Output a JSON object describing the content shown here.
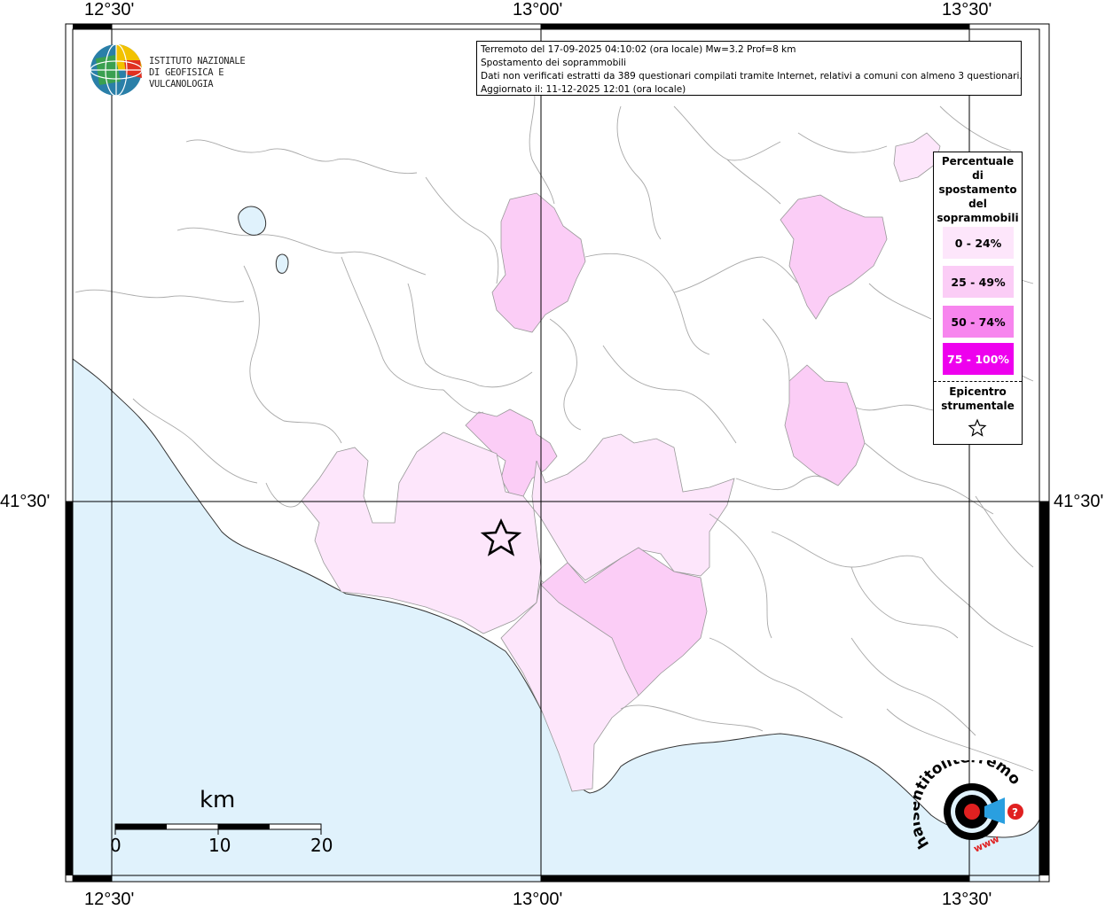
{
  "map": {
    "lon_labels": [
      "12°30'",
      "13°00'",
      "13°30'"
    ],
    "lat_label": "41°30'",
    "colors": {
      "sea": "#e0f2fc",
      "land": "#ffffff",
      "border": "#aaaaaa",
      "c0_24": "#fde6fb",
      "c25_49": "#fbcdf6",
      "c50_74": "#f785ee",
      "c75_100": "#ee00ee"
    }
  },
  "info": {
    "line1": "Terremoto del 17-09-2025 04:10:02 (ora locale) Mw=3.2 Prof=8 km",
    "line2": "Spostamento dei soprammobili",
    "line3": "Dati non verificati estratti da 389 questionari compilati tramite Internet, relativi a comuni con almeno 3 questionari.",
    "line4": "Aggiornato il: 11-12-2025 12:01 (ora locale)"
  },
  "logo": {
    "line1": "ISTITUTO NAZIONALE",
    "line2": "DI GEOFISICA E VULCANOLOGIA"
  },
  "legend": {
    "title_lines": [
      "Percentuale",
      "di",
      "spostamento",
      "del",
      "soprammobili"
    ],
    "items": [
      {
        "label": "0 - 24%",
        "color": "#fde6fb",
        "text_color": "#000"
      },
      {
        "label": "25 - 49%",
        "color": "#fbcdf6",
        "text_color": "#000"
      },
      {
        "label": "50 - 74%",
        "color": "#f785ee",
        "text_color": "#000"
      },
      {
        "label": "75 - 100%",
        "color": "#ee00ee",
        "text_color": "#ffffff"
      }
    ],
    "epicenter_lines": [
      "Epicentro",
      "strumentale"
    ],
    "epicenter_icon": "star-icon"
  },
  "scale": {
    "unit": "km",
    "ticks": [
      "0",
      "10",
      "20"
    ]
  },
  "watermark": {
    "text": "haisentitoilterremoto.it",
    "url_text": "www"
  }
}
